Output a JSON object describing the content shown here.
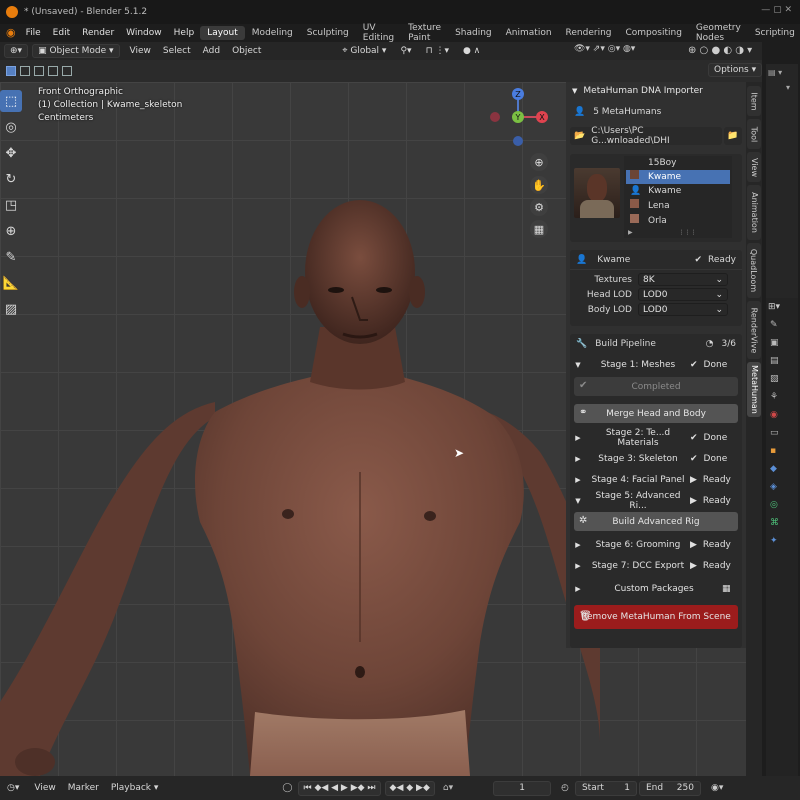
{
  "window": {
    "title": "* (Unsaved) - Blender 5.1.2"
  },
  "menubar": {
    "menus": [
      "File",
      "Edit",
      "Render",
      "Window",
      "Help"
    ],
    "workspaces": [
      "Layout",
      "Modeling",
      "Sculpting",
      "UV Editing",
      "Texture Paint",
      "Shading",
      "Animation",
      "Rendering",
      "Compositing",
      "Geometry Nodes",
      "Scripting"
    ],
    "active_workspace": "Layout"
  },
  "header": {
    "mode": "Object Mode",
    "menus": [
      "View",
      "Select",
      "Add",
      "Object"
    ],
    "orientation": "Global",
    "options_label": "Options"
  },
  "viewport": {
    "view_name": "Front Orthographic",
    "collection": "(1) Collection | Kwame_skeleton",
    "units": "Centimeters",
    "gizmo": {
      "z": "Z",
      "y": "Y",
      "x": "X"
    }
  },
  "panel": {
    "title": "MetaHuman DNA Importer",
    "count_label": "5 MetaHumans",
    "path": "C:\\Users\\PC G...wnloaded\\DHI",
    "list_header": "15Boy",
    "list": [
      {
        "name": "Kwame",
        "selected": true
      },
      {
        "name": "Kwame",
        "selected": false
      },
      {
        "name": "Lena",
        "selected": false
      },
      {
        "name": "Orla",
        "selected": false
      }
    ],
    "character": {
      "name": "Kwame",
      "status": "Ready"
    },
    "textures": {
      "label": "Textures",
      "value": "8K"
    },
    "head_lod": {
      "label": "Head LOD",
      "value": "LOD0"
    },
    "body_lod": {
      "label": "Body LOD",
      "value": "LOD0"
    },
    "pipeline": {
      "title": "Build Pipeline",
      "progress": "3/6"
    },
    "stage1": {
      "label": "Stage 1: Meshes",
      "status": "Done"
    },
    "completed_label": "Completed",
    "merge_label": "Merge Head and Body",
    "stage2": {
      "label": "Stage 2: Te...d Materials",
      "status": "Done"
    },
    "stage3": {
      "label": "Stage 3: Skeleton",
      "status": "Done"
    },
    "stage4": {
      "label": "Stage 4: Facial Panel",
      "status": "Ready"
    },
    "stage5": {
      "label": "Stage 5: Advanced Ri...",
      "status": "Ready"
    },
    "build_rig_label": "Build Advanced Rig",
    "stage6": {
      "label": "Stage 6: Grooming",
      "status": "Ready"
    },
    "stage7": {
      "label": "Stage 7: DCC Export",
      "status": "Ready"
    },
    "custom_packages": "Custom Packages",
    "remove_label": "Remove MetaHuman From Scene"
  },
  "vtabs": [
    "Item",
    "Tool",
    "View",
    "Animation",
    "QuadLoom",
    "RenderVive",
    "MetaHuman"
  ],
  "timeline": {
    "menus": [
      "View",
      "Marker",
      "Playback"
    ],
    "current_frame": "1",
    "start_label": "Start",
    "start": "1",
    "end_label": "End",
    "end": "250"
  },
  "colors": {
    "accent": "#4772b3",
    "remove_button": "#9b1c1c",
    "blender_orange": "#e87d0d"
  }
}
